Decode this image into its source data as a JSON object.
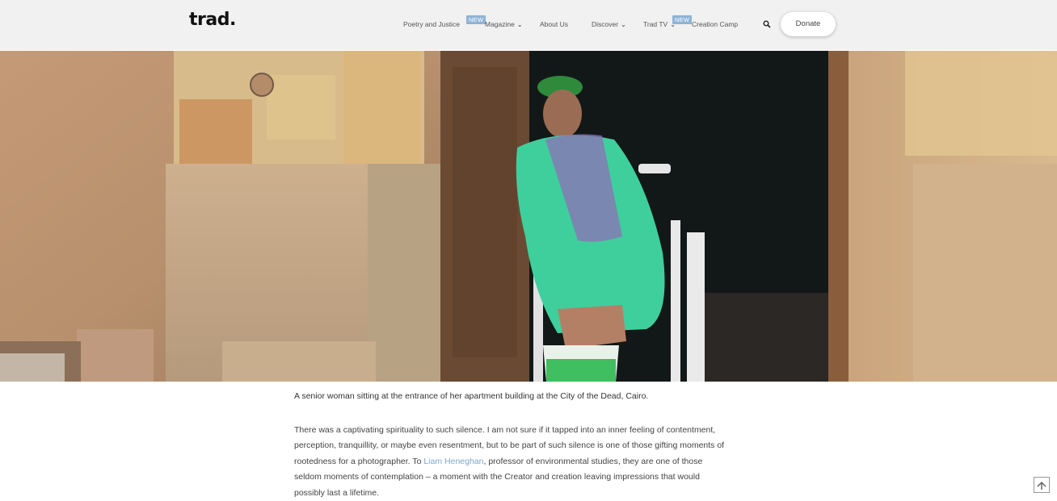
{
  "header": {
    "logo": "trad.",
    "nav": [
      {
        "label": "Poetry and Justice",
        "has_dropdown": false
      },
      {
        "label": "Magazine",
        "has_dropdown": true,
        "badge": "NEW"
      },
      {
        "label": "About Us",
        "has_dropdown": false
      },
      {
        "label": "Discover",
        "has_dropdown": true
      },
      {
        "label": "Trad TV",
        "has_dropdown": true
      },
      {
        "label": "Creation Camp",
        "has_dropdown": false,
        "badge": "NEW"
      }
    ],
    "donate_label": "Donate",
    "search_icon": "search-icon"
  },
  "article": {
    "caption": "A senior woman sitting at the entrance of her apartment building at the City of the Dead, Cairo.",
    "paragraph_before_link": "There was a captivating spirituality to such silence. I am not sure if it tapped into an inner feeling of contentment, perception, tranquillity, or maybe even resentment, but to be part of such silence is one of those gifting moments of rootedness for a photographer. To ",
    "link_text": "Liam Heneghan",
    "paragraph_after_link": ", professor of environmental studies, they are one of those seldom moments of contemplation – a moment with the Creator and creation leaving impressions that would possibly last a lifetime."
  },
  "colors": {
    "header_bg": "#f1f1f1",
    "badge": "#8fb3d6",
    "link": "#7fa7cf"
  },
  "icons": {
    "scroll_top": "arrow-up-icon",
    "dropdown": "chevron-down-icon"
  }
}
